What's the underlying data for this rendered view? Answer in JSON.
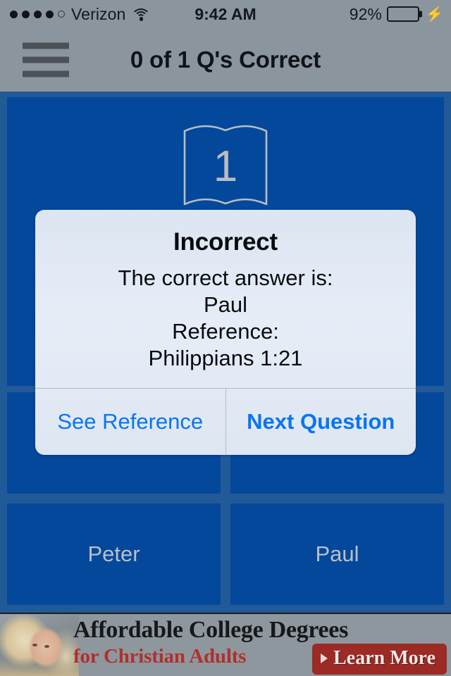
{
  "status_bar": {
    "carrier": "Verizon",
    "signal_dots_filled": 4,
    "signal_dots_total": 5,
    "wifi_icon": "wifi-icon",
    "time": "9:42 AM",
    "battery_percent": "92%",
    "battery_level": 92,
    "battery_color": "#2ea33c",
    "charging_icon": "⚡"
  },
  "nav": {
    "menu_icon": "hamburger-menu-icon",
    "title": "0 of 1 Q's Correct",
    "background_color": "#8b959d"
  },
  "quiz": {
    "background_color": "#215a96",
    "tile_color": "#04489c",
    "text_color": "#b9bfc6",
    "book_icon": "open-book-icon",
    "question_number": "1",
    "question_text": "",
    "answers": [
      {
        "label": ""
      },
      {
        "label": ""
      },
      {
        "label": "Peter"
      },
      {
        "label": "Paul"
      }
    ]
  },
  "dialog": {
    "title": "Incorrect",
    "lines": [
      "The correct answer is:",
      "Paul",
      "Reference:",
      "Philippians 1:21"
    ],
    "buttons": [
      {
        "label": "See Reference",
        "emphasis": "normal"
      },
      {
        "label": "Next Question",
        "emphasis": "bold"
      }
    ],
    "link_color": "#0a75f0"
  },
  "ad": {
    "headline": "Affordable College Degrees",
    "subhead": "for Christian Adults",
    "cta_label": "Learn More",
    "cta_color": "#9c2a25",
    "photo_alt": "woman-photo"
  }
}
